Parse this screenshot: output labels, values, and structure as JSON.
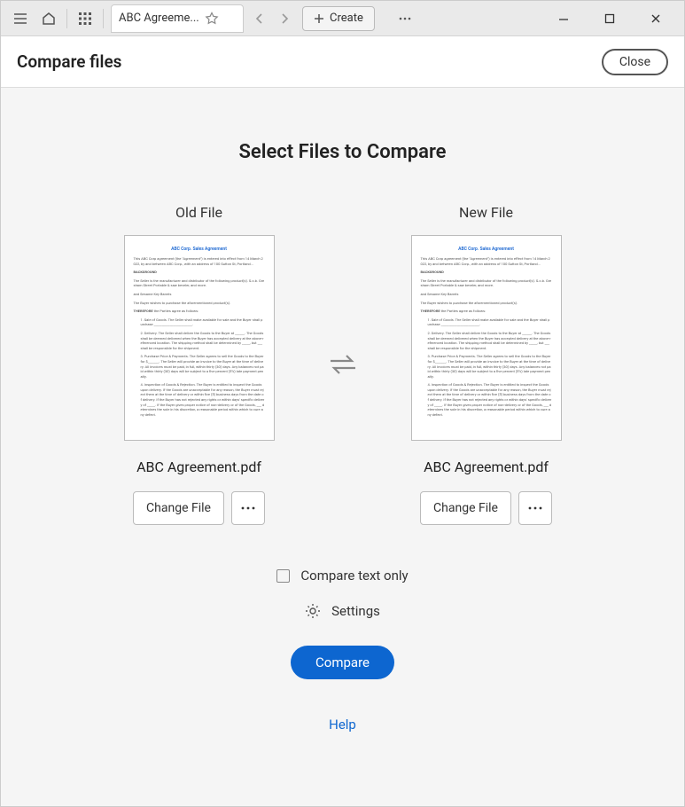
{
  "titlebar": {
    "tab_name": "ABC Agreeme...",
    "create_label": "Create"
  },
  "header": {
    "title": "Compare files",
    "close_label": "Close"
  },
  "main": {
    "title": "Select Files to Compare",
    "old_label": "Old File",
    "new_label": "New File",
    "old_file": {
      "name": "ABC Agreement.pdf",
      "change_label": "Change File",
      "thumb_title": "ABC Corp. Sales Agreement"
    },
    "new_file": {
      "name": "ABC Agreement.pdf",
      "change_label": "Change File",
      "thumb_title": "ABC Corp. Sales Agreement"
    },
    "compare_text_only_label": "Compare text only",
    "settings_label": "Settings",
    "compare_label": "Compare",
    "help_label": "Help"
  }
}
